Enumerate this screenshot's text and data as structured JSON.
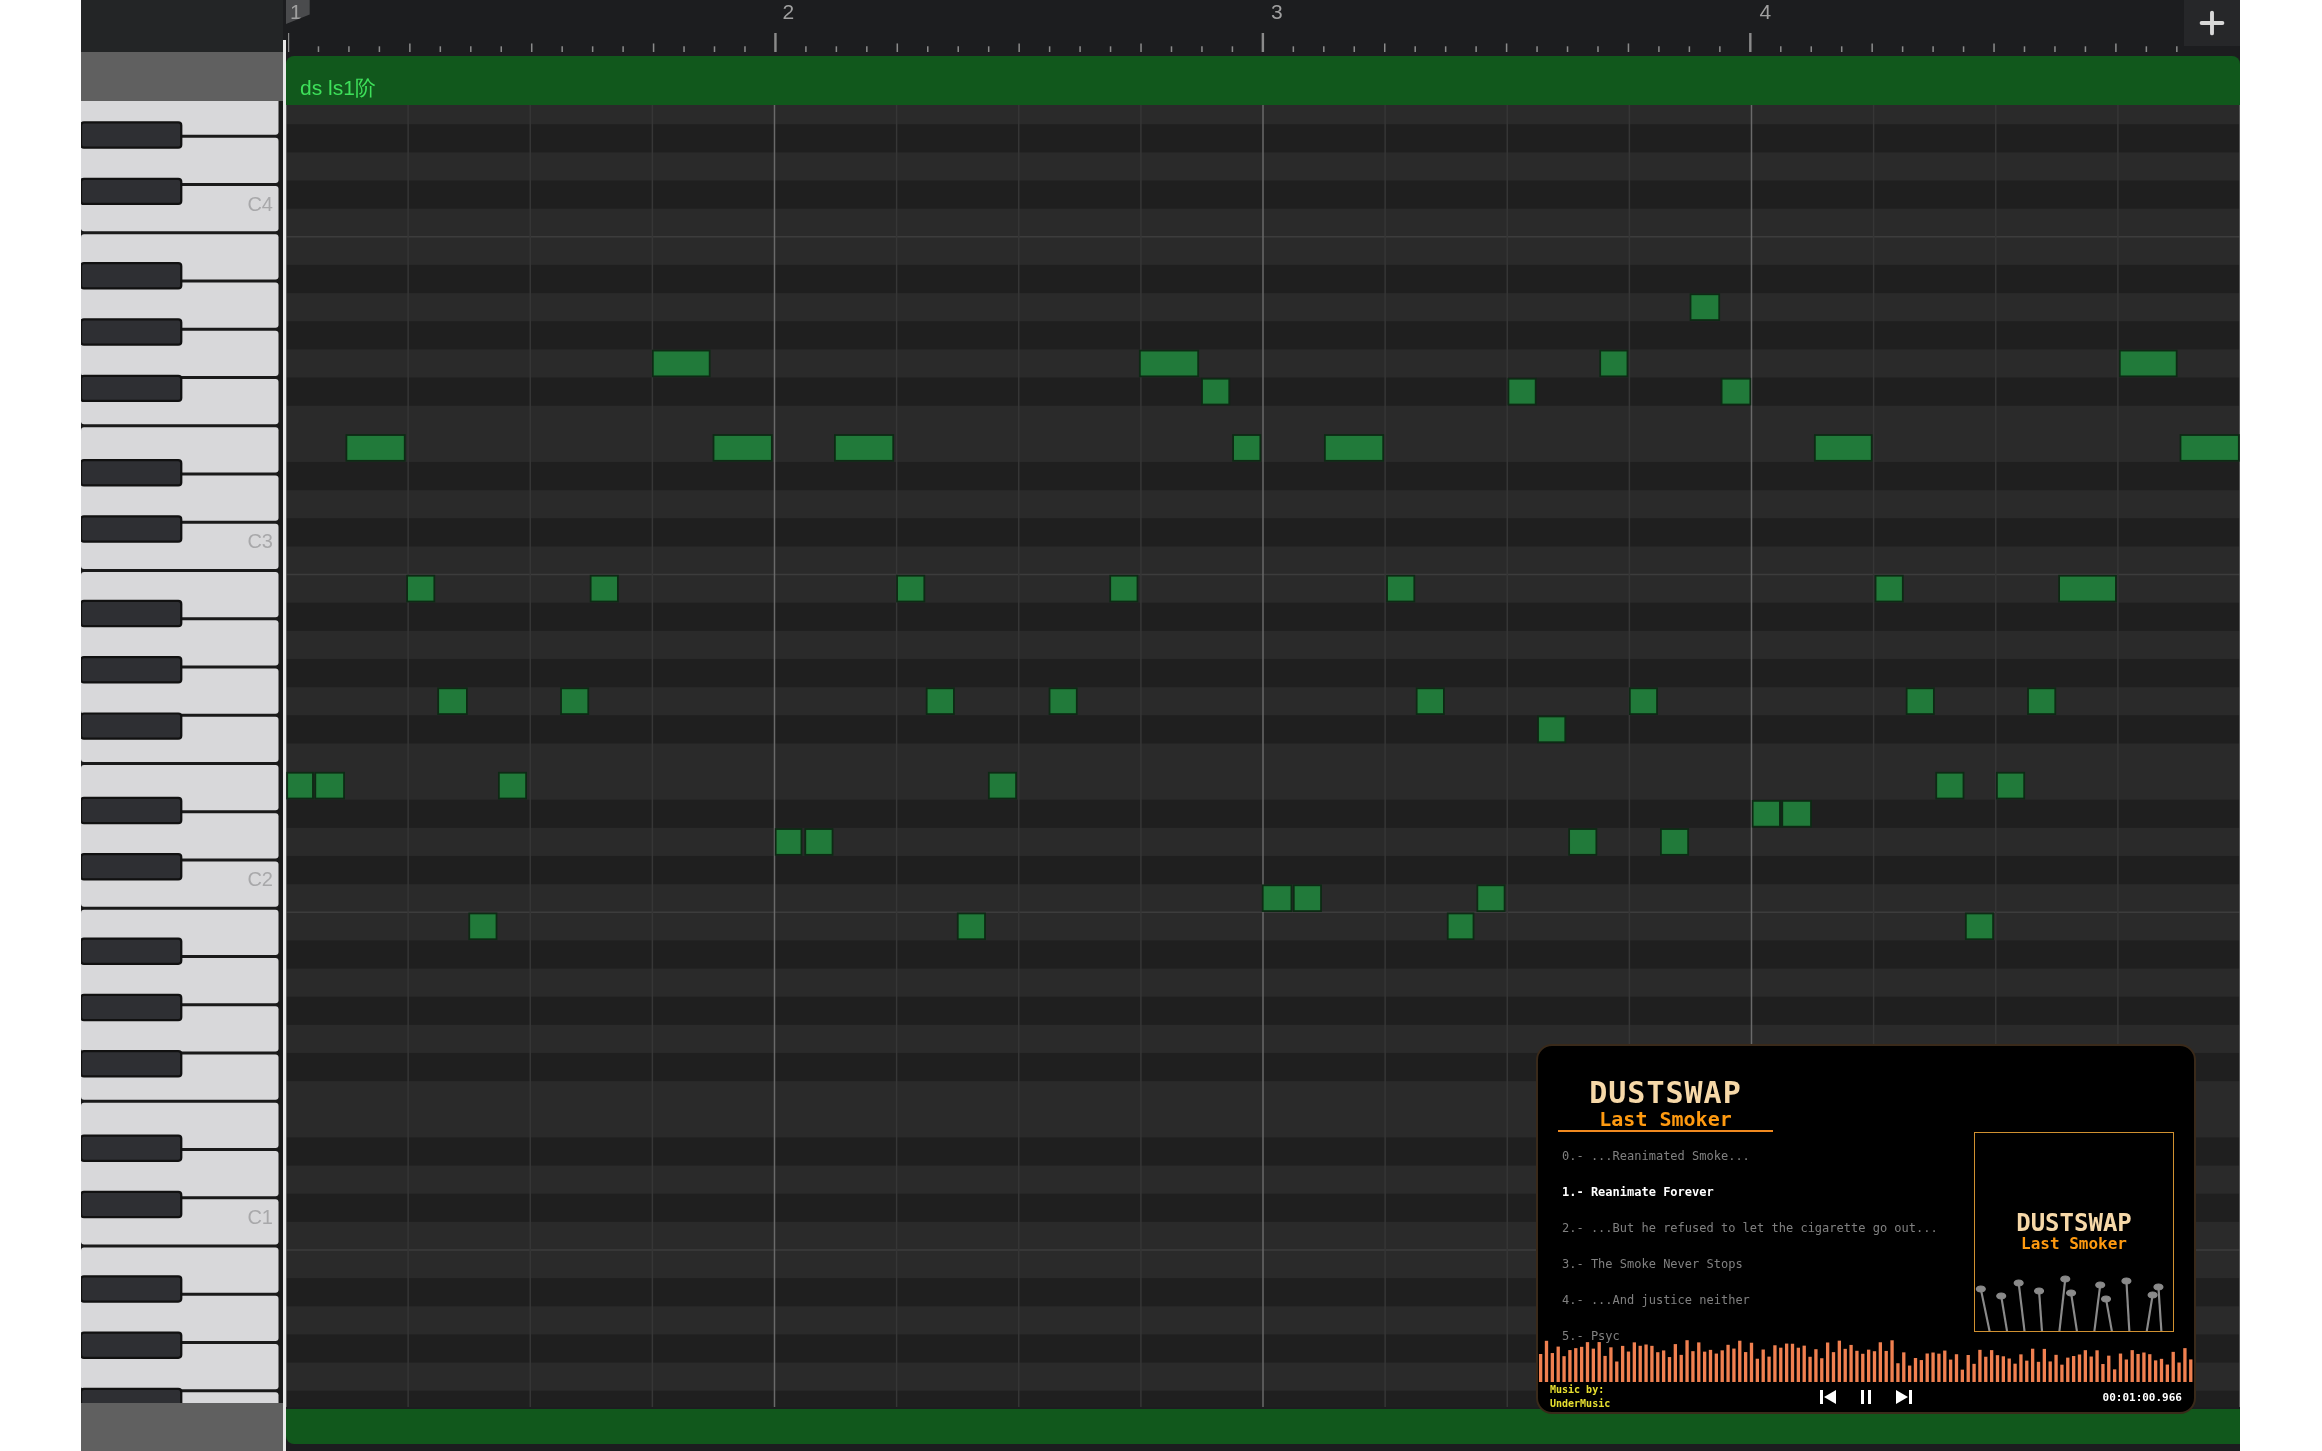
{
  "ruler": {
    "bars": [
      "1",
      "2",
      "3",
      "4"
    ]
  },
  "region": {
    "name": "ds ls1阶"
  },
  "keyboard": {
    "labels": [
      "C4",
      "C3",
      "C2",
      "C1"
    ]
  },
  "player": {
    "logo": {
      "title": "DUSTSWAP",
      "subtitle": "Last Smoker"
    },
    "tracks": [
      {
        "label": "0.- ...Reanimated Smoke...",
        "selected": false
      },
      {
        "label": "1.- Reanimate Forever",
        "selected": true
      },
      {
        "label": "2.- ...But he refused to let the cigarette go out...",
        "selected": false
      },
      {
        "label": "3.- The Smoke Never Stops",
        "selected": false
      },
      {
        "label": "4.- ...And justice neither",
        "selected": false
      },
      {
        "label": "5.- Psyc",
        "selected": false
      }
    ],
    "cover": {
      "title": "DUSTSWAP",
      "subtitle": "Last Smoker"
    },
    "credit": [
      "Music by:",
      "UnderMusic"
    ],
    "time": "00:01:00.966"
  }
}
